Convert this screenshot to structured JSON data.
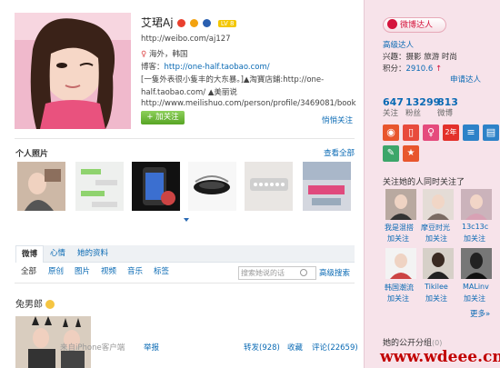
{
  "profile": {
    "name": "艾珺Aj",
    "level": "LV 8",
    "url": "http://weibo.com/aj127",
    "location": "海外，韩国",
    "blog_label": "博客：",
    "blog_url": "http://one-half.taobao.com/",
    "bio_line1": "[一隻外表很小隻丰的大东暴。]▲淘寶店鋪:http://one-",
    "bio_line2": "half.taobao.com/ ▲美丽说",
    "bio_line3": "http://www.meilishuo.com/person/profile/3469081/book",
    "follow_label": "+ 加关注",
    "close_follow": "悄悄关注"
  },
  "photos_section": {
    "title": "个人照片",
    "view_all": "查看全部"
  },
  "tabs": [
    "微博",
    "心情",
    "她的资料"
  ],
  "filters": [
    "全部",
    "原创",
    "图片",
    "视频",
    "音乐",
    "标签"
  ],
  "search": {
    "placeholder": "搜索她说的话",
    "advanced": "高级搜索"
  },
  "post": {
    "text": "兔男郎",
    "source": "来自iPhone客户端",
    "report": "举报",
    "forward": "转发(928)",
    "collect": "收藏",
    "comment": "评论(22659)"
  },
  "watermark": "www.wdeee.cn",
  "sidebar": {
    "talent_label": "微博达人",
    "talent_sub": "高级达人",
    "interests": "兴趣：摄影 旅游 时尚",
    "points_label": "积分：",
    "points_value": "2910.6",
    "apply": "申请达人",
    "stats": [
      {
        "num": "647",
        "label": "关注"
      },
      {
        "num": "13299",
        "label": "粉丝"
      },
      {
        "num": "813",
        "label": "微博"
      }
    ],
    "icon_year": "2年",
    "also_follow_title": "关注她的人同时关注了",
    "following": [
      {
        "name": "我是混搭",
        "add": "加关注"
      },
      {
        "name": "摩豆时光",
        "add": "加关注"
      },
      {
        "name": "13c13c",
        "add": "加关注"
      },
      {
        "name": "韩国潮流",
        "add": "加关注"
      },
      {
        "name": "Tikilee",
        "add": "加关注"
      },
      {
        "name": "MALinv",
        "add": "加关注"
      }
    ],
    "more": "更多»",
    "public_group": "她的公开分组",
    "public_group_count": "(0)"
  }
}
